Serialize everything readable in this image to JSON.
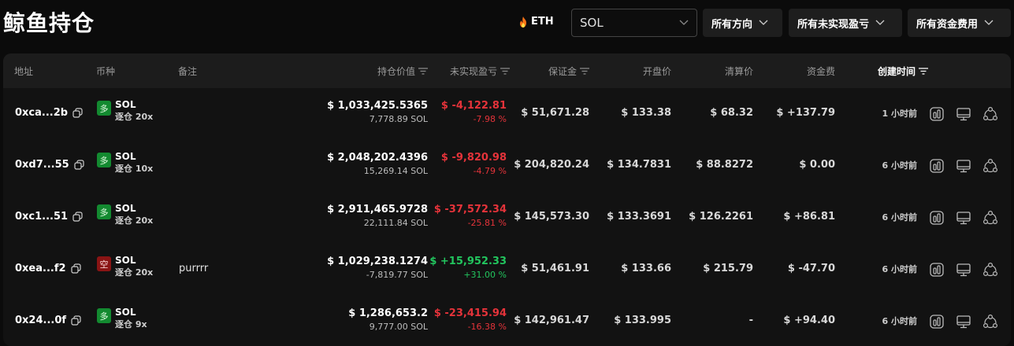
{
  "header": {
    "title": "鲸鱼持仓",
    "eth_label": "ETH",
    "coin_select": "SOL",
    "filter_direction": "所有方向",
    "filter_pnl": "所有未实现盈亏",
    "filter_funding": "所有资金费用"
  },
  "table": {
    "columns": {
      "address": "地址",
      "coin": "币种",
      "note": "备注",
      "value": "持仓价值",
      "pnl": "未实现盈亏",
      "margin": "保证金",
      "open_price": "开盘价",
      "liq_price": "清算价",
      "funding": "资金费",
      "created": "创建时间"
    },
    "rows": [
      {
        "address": "0xca...2b",
        "coin": "SOL",
        "side": "多",
        "side_type": "long",
        "leverage": "逐仓 20x",
        "note": "",
        "value": "$ 1,033,425.5365",
        "size": "7,778.89 SOL",
        "pnl": "$ -4,122.81",
        "pnl_pct": "-7.98 %",
        "pnl_sign": "red",
        "margin": "$ 51,671.28",
        "open_price": "$ 133.38",
        "liq_price": "$ 68.32",
        "funding": "$ +137.79",
        "funding_sign": "green",
        "created": "1 小时前"
      },
      {
        "address": "0xd7...55",
        "coin": "SOL",
        "side": "多",
        "side_type": "long",
        "leverage": "逐仓 10x",
        "note": "",
        "value": "$ 2,048,202.4396",
        "size": "15,269.14 SOL",
        "pnl": "$ -9,820.98",
        "pnl_pct": "-4.79 %",
        "pnl_sign": "red",
        "margin": "$ 204,820.24",
        "open_price": "$ 134.7831",
        "liq_price": "$ 88.8272",
        "funding": "$ 0.00",
        "funding_sign": "neutral",
        "created": "6 小时前"
      },
      {
        "address": "0xc1...51",
        "coin": "SOL",
        "side": "多",
        "side_type": "long",
        "leverage": "逐仓 20x",
        "note": "",
        "value": "$ 2,911,465.9728",
        "size": "22,111.84 SOL",
        "pnl": "$ -37,572.34",
        "pnl_pct": "-25.81 %",
        "pnl_sign": "red",
        "margin": "$ 145,573.30",
        "open_price": "$ 133.3691",
        "liq_price": "$ 126.2261",
        "funding": "$ +86.81",
        "funding_sign": "green",
        "created": "6 小时前"
      },
      {
        "address": "0xea...f2",
        "coin": "SOL",
        "side": "空",
        "side_type": "short",
        "leverage": "逐仓 20x",
        "note": "purrrr",
        "value": "$ 1,029,238.1274",
        "size": "-7,819.77 SOL",
        "pnl": "$ +15,952.33",
        "pnl_pct": "+31.00 %",
        "pnl_sign": "green",
        "margin": "$ 51,461.91",
        "open_price": "$ 133.66",
        "liq_price": "$ 215.79",
        "funding": "$ -47.70",
        "funding_sign": "red",
        "created": "6 小时前"
      },
      {
        "address": "0x24...0f",
        "coin": "SOL",
        "side": "多",
        "side_type": "long",
        "leverage": "逐仓 9x",
        "note": "",
        "value": "$ 1,286,653.2",
        "size": "9,777.00 SOL",
        "pnl": "$ -23,415.94",
        "pnl_pct": "-16.38 %",
        "pnl_sign": "red",
        "margin": "$ 142,961.47",
        "open_price": "$ 133.995",
        "liq_price": "-",
        "funding": "$ +94.40",
        "funding_sign": "green",
        "created": "6 小时前"
      }
    ]
  },
  "colors": {
    "red": "#e5333a",
    "green": "#22c55e",
    "long_badge": "#138a30",
    "short_badge": "#8a1414"
  }
}
